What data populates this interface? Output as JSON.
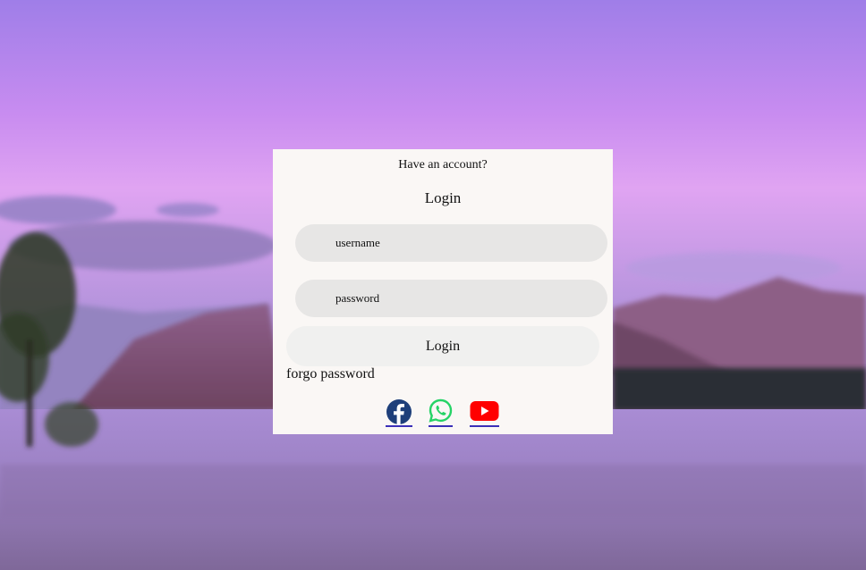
{
  "form": {
    "tagline": "Have an account?",
    "title": "Login",
    "username_placeholder": "username",
    "password_placeholder": "password",
    "submit_label": "Login",
    "forgot_link": "forgo password"
  },
  "social_links": [
    {
      "name": "facebook-icon",
      "color": "#1e3f7a"
    },
    {
      "name": "whatsapp-icon",
      "color": "#25d366"
    },
    {
      "name": "youtube-icon",
      "color": "#ff0000"
    }
  ],
  "background": {
    "description_colors": {
      "sky": "#d89ef0",
      "mountains": "#7e4d6e",
      "water": "#9f86c4"
    }
  }
}
